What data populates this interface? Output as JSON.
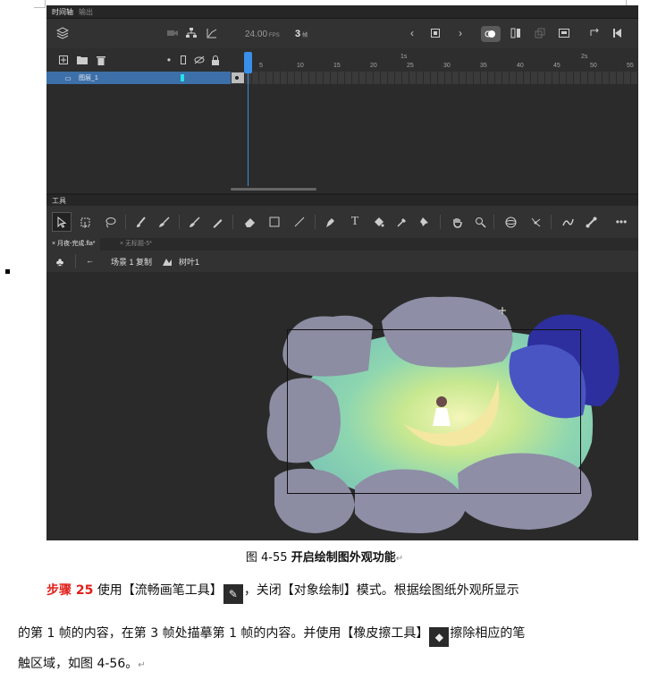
{
  "app": {
    "panel_tabs": [
      "时间轴",
      "输出"
    ],
    "fps": "24.00",
    "fps_unit": "FPS",
    "current_frame": "3",
    "frame_unit": "帧",
    "layer_name": "图层_1",
    "ruler_ticks": [
      {
        "label": "1s",
        "kind": "sec"
      },
      {
        "label": "2s",
        "kind": "sec"
      },
      {
        "label": "5"
      },
      {
        "label": "10"
      },
      {
        "label": "15"
      },
      {
        "label": "20"
      },
      {
        "label": "25"
      },
      {
        "label": "30"
      },
      {
        "label": "35"
      },
      {
        "label": "40"
      },
      {
        "label": "45"
      },
      {
        "label": "50"
      },
      {
        "label": "55"
      }
    ],
    "tools_title": "工具",
    "doc_tabs": [
      {
        "label": "月夜-完成.fla*",
        "active": true
      },
      {
        "label": "无标题-5*",
        "active": false
      }
    ],
    "breadcrumb": {
      "back": "←",
      "scene": "场景 1 复制",
      "symbol": "树叶1"
    },
    "icons": {
      "layers": "layers-icon",
      "camera": "camera-icon",
      "hierarchy": "hierarchy-icon",
      "graph": "graph-icon",
      "prev": "prev-frame-icon",
      "stop": "stop-icon",
      "next": "next-frame-icon",
      "onion": "onion-skin-icon"
    }
  },
  "caption": {
    "prefix": "图 4-55",
    "text": "开启绘制图外观功能"
  },
  "paragraph": {
    "step_label": "步骤 25",
    "line1_a": "使用【流畅画笔工具】",
    "line1_b": "，关闭【对象绘制】模式。根据绘图纸外观所显示",
    "line2_a": "的第 1 帧的内容，在第 3 帧处描摹第 1 帧的内容。并使用【橡皮擦工具】",
    "line2_b": "擦除相应的笔",
    "line3": "触区域，如图 4-56。"
  },
  "colors": {
    "step": "#e0201b",
    "layer_highlight": "#3d6fa8",
    "playhead": "#3a8fe8"
  }
}
